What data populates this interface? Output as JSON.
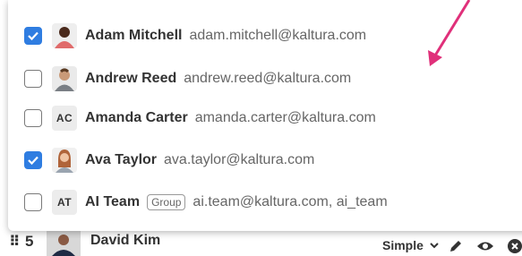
{
  "options": [
    {
      "checked": true,
      "avatar": "person-photo-icon",
      "initials": null,
      "name": "Adam Mitchell",
      "email": "adam.mitchell@kaltura.com",
      "badge": null
    },
    {
      "checked": false,
      "avatar": "person-photo-icon",
      "initials": null,
      "name": "Andrew Reed",
      "email": "andrew.reed@kaltura.com",
      "badge": null
    },
    {
      "checked": false,
      "avatar": null,
      "initials": "AC",
      "name": "Amanda Carter",
      "email": "amanda.carter@kaltura.com",
      "badge": null
    },
    {
      "checked": true,
      "avatar": "person-photo-icon",
      "initials": null,
      "name": "Ava Taylor",
      "email": "ava.taylor@kaltura.com",
      "badge": null
    },
    {
      "checked": false,
      "avatar": null,
      "initials": "AT",
      "name": "AI Team",
      "email": "ai.team@kaltura.com, ai_team",
      "badge": "Group"
    }
  ],
  "background_row": {
    "drag_icon": "drag-handle-icon",
    "number": "5",
    "name": "David Kim",
    "role": "Simple",
    "icons": [
      "chevron-down-icon",
      "pencil-icon",
      "eye-icon",
      "close-circle-icon"
    ]
  },
  "annotation": {
    "icon": "pointer-arrow",
    "color": "#e0307a"
  },
  "colors": {
    "checkbox_checked": "#2f7de1",
    "border": "#7a7a7a"
  }
}
